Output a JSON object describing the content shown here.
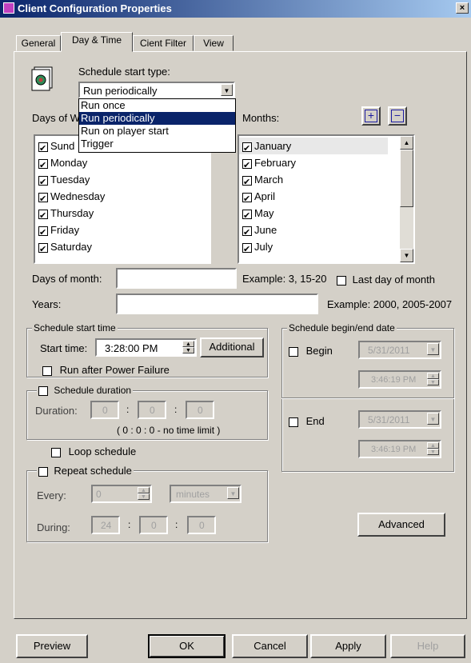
{
  "window": {
    "title": "Client Configuration Properties",
    "close_label": "×"
  },
  "tabs": [
    {
      "label": "General"
    },
    {
      "label": "Day & Time"
    },
    {
      "label": "Cient Filter"
    },
    {
      "label": "View"
    }
  ],
  "schedule_type": {
    "label": "Schedule start type:",
    "selected": "Run periodically",
    "options": [
      "Run once",
      "Run periodically",
      "Run on player start",
      "Trigger"
    ]
  },
  "days_of_week": {
    "label": "Days of W",
    "items": [
      {
        "label": "Sund",
        "checked": true
      },
      {
        "label": "Monday",
        "checked": true
      },
      {
        "label": "Tuesday",
        "checked": true
      },
      {
        "label": "Wednesday",
        "checked": true
      },
      {
        "label": "Thursday",
        "checked": true
      },
      {
        "label": "Friday",
        "checked": true
      },
      {
        "label": "Saturday",
        "checked": true
      }
    ]
  },
  "months": {
    "label": "Months:",
    "add_label": "+",
    "remove_label": "−",
    "items": [
      {
        "label": "January",
        "checked": true
      },
      {
        "label": "February",
        "checked": true
      },
      {
        "label": "March",
        "checked": true
      },
      {
        "label": "April",
        "checked": true
      },
      {
        "label": "May",
        "checked": true
      },
      {
        "label": "June",
        "checked": true
      },
      {
        "label": "July",
        "checked": true
      }
    ]
  },
  "days_of_month": {
    "label": "Days of month:",
    "value": "",
    "example": "Example: 3, 15-20",
    "last_day_label": "Last day of month",
    "last_day_checked": false
  },
  "years": {
    "label": "Years:",
    "value": "",
    "example": "Example: 2000, 2005-2007"
  },
  "start_time": {
    "group_label": "Schedule start time",
    "label": "Start time:",
    "value": "3:28:00 PM",
    "additional_label": "Additional",
    "power_failure_label": "Run after Power Failure",
    "power_failure_checked": false
  },
  "duration": {
    "group_label": "Schedule duration",
    "checked": false,
    "label": "Duration:",
    "h": "0",
    "m": "0",
    "s": "0",
    "note": "( 0 : 0 : 0 - no time limit )"
  },
  "loop": {
    "label": "Loop schedule",
    "checked": false
  },
  "repeat": {
    "group_label": "Repeat schedule",
    "checked": false,
    "every_label": "Every:",
    "every_value": "0",
    "unit": "minutes",
    "during_label": "During:",
    "during_h": "24",
    "during_m": "0",
    "during_s": "0"
  },
  "begin_end": {
    "group_label": "Schedule begin/end date",
    "begin_label": "Begin",
    "begin_checked": false,
    "begin_date": "5/31/2011",
    "begin_time": "3:46:19 PM",
    "end_label": "End",
    "end_checked": false,
    "end_date": "5/31/2011",
    "end_time": "3:46:19 PM"
  },
  "advanced_label": "Advanced",
  "buttons": {
    "preview": "Preview",
    "ok": "OK",
    "cancel": "Cancel",
    "apply": "Apply",
    "help": "Help"
  }
}
